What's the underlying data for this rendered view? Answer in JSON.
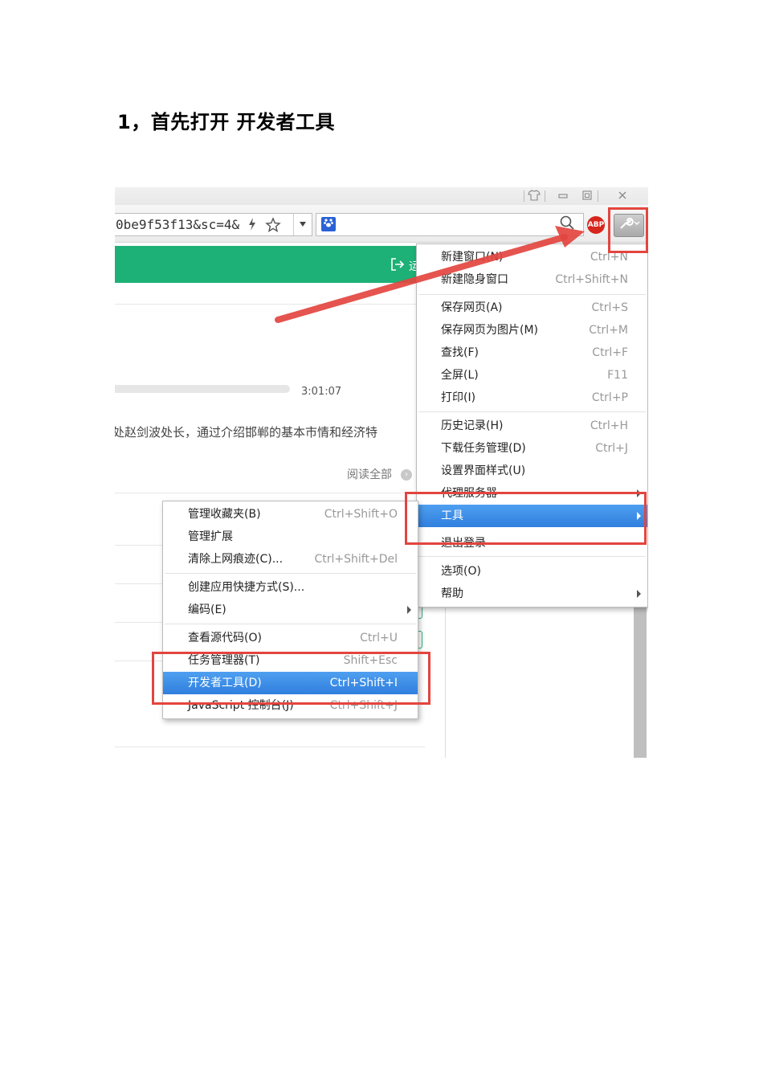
{
  "heading": "1，首先打开 开发者工具",
  "browser": {
    "address_text": "0be9f53f13&sc=4&",
    "icons": {
      "window_controls": [
        "shirt-icon",
        "minimize-icon",
        "restore-icon",
        "close-icon"
      ],
      "address_bar": [
        "lightning-icon",
        "star-icon",
        "dropdown-icon"
      ],
      "search": [
        "baidu-paw-icon",
        "search-icon"
      ],
      "extensions": [
        "adblock-plus-icon",
        "wrench-icon"
      ]
    }
  },
  "page": {
    "login_text": "运",
    "time": "3:01:07",
    "article_text": "处赵剑波处长，通过介绍邯郸的基本市情和经济特",
    "read_all": "阅读全部",
    "accent_color": "#1db077"
  },
  "main_menu": {
    "items": [
      {
        "label": "新建窗口(N)",
        "shortcut": "Ctrl+N"
      },
      {
        "label": "新建隐身窗口",
        "shortcut": "Ctrl+Shift+N"
      },
      {
        "label": "保存网页(A)",
        "shortcut": "Ctrl+S"
      },
      {
        "label": "保存网页为图片(M)",
        "shortcut": "Ctrl+M"
      },
      {
        "label": "查找(F)",
        "shortcut": "Ctrl+F"
      },
      {
        "label": "全屏(L)",
        "shortcut": "F11"
      },
      {
        "label": "打印(I)",
        "shortcut": "Ctrl+P"
      },
      {
        "label": "历史记录(H)",
        "shortcut": "Ctrl+H"
      },
      {
        "label": "下载任务管理(D)",
        "shortcut": "Ctrl+J"
      },
      {
        "label": "设置界面样式(U)",
        "shortcut": ""
      },
      {
        "label": "代理服务器",
        "shortcut": ""
      },
      {
        "label": "工具",
        "shortcut": ""
      },
      {
        "label": "退出登录",
        "shortcut": ""
      },
      {
        "label": "选项(O)",
        "shortcut": ""
      },
      {
        "label": "帮助",
        "shortcut": ""
      }
    ]
  },
  "tools_submenu": {
    "items": [
      {
        "label": "管理收藏夹(B)",
        "shortcut": "Ctrl+Shift+O"
      },
      {
        "label": "管理扩展",
        "shortcut": ""
      },
      {
        "label": "清除上网痕迹(C)...",
        "shortcut": "Ctrl+Shift+Del"
      },
      {
        "label": "创建应用快捷方式(S)...",
        "shortcut": ""
      },
      {
        "label": "编码(E)",
        "shortcut": ""
      },
      {
        "label": "查看源代码(O)",
        "shortcut": "Ctrl+U"
      },
      {
        "label": "任务管理器(T)",
        "shortcut": "Shift+Esc"
      },
      {
        "label": "开发者工具(D)",
        "shortcut": "Ctrl+Shift+I"
      },
      {
        "label": "JavaScript 控制台(J)",
        "shortcut": "Ctrl+Shift+J"
      }
    ]
  },
  "annotation": {
    "highlight_color": "#e3453f",
    "menu_highlight_color": "#3a8ae6"
  }
}
